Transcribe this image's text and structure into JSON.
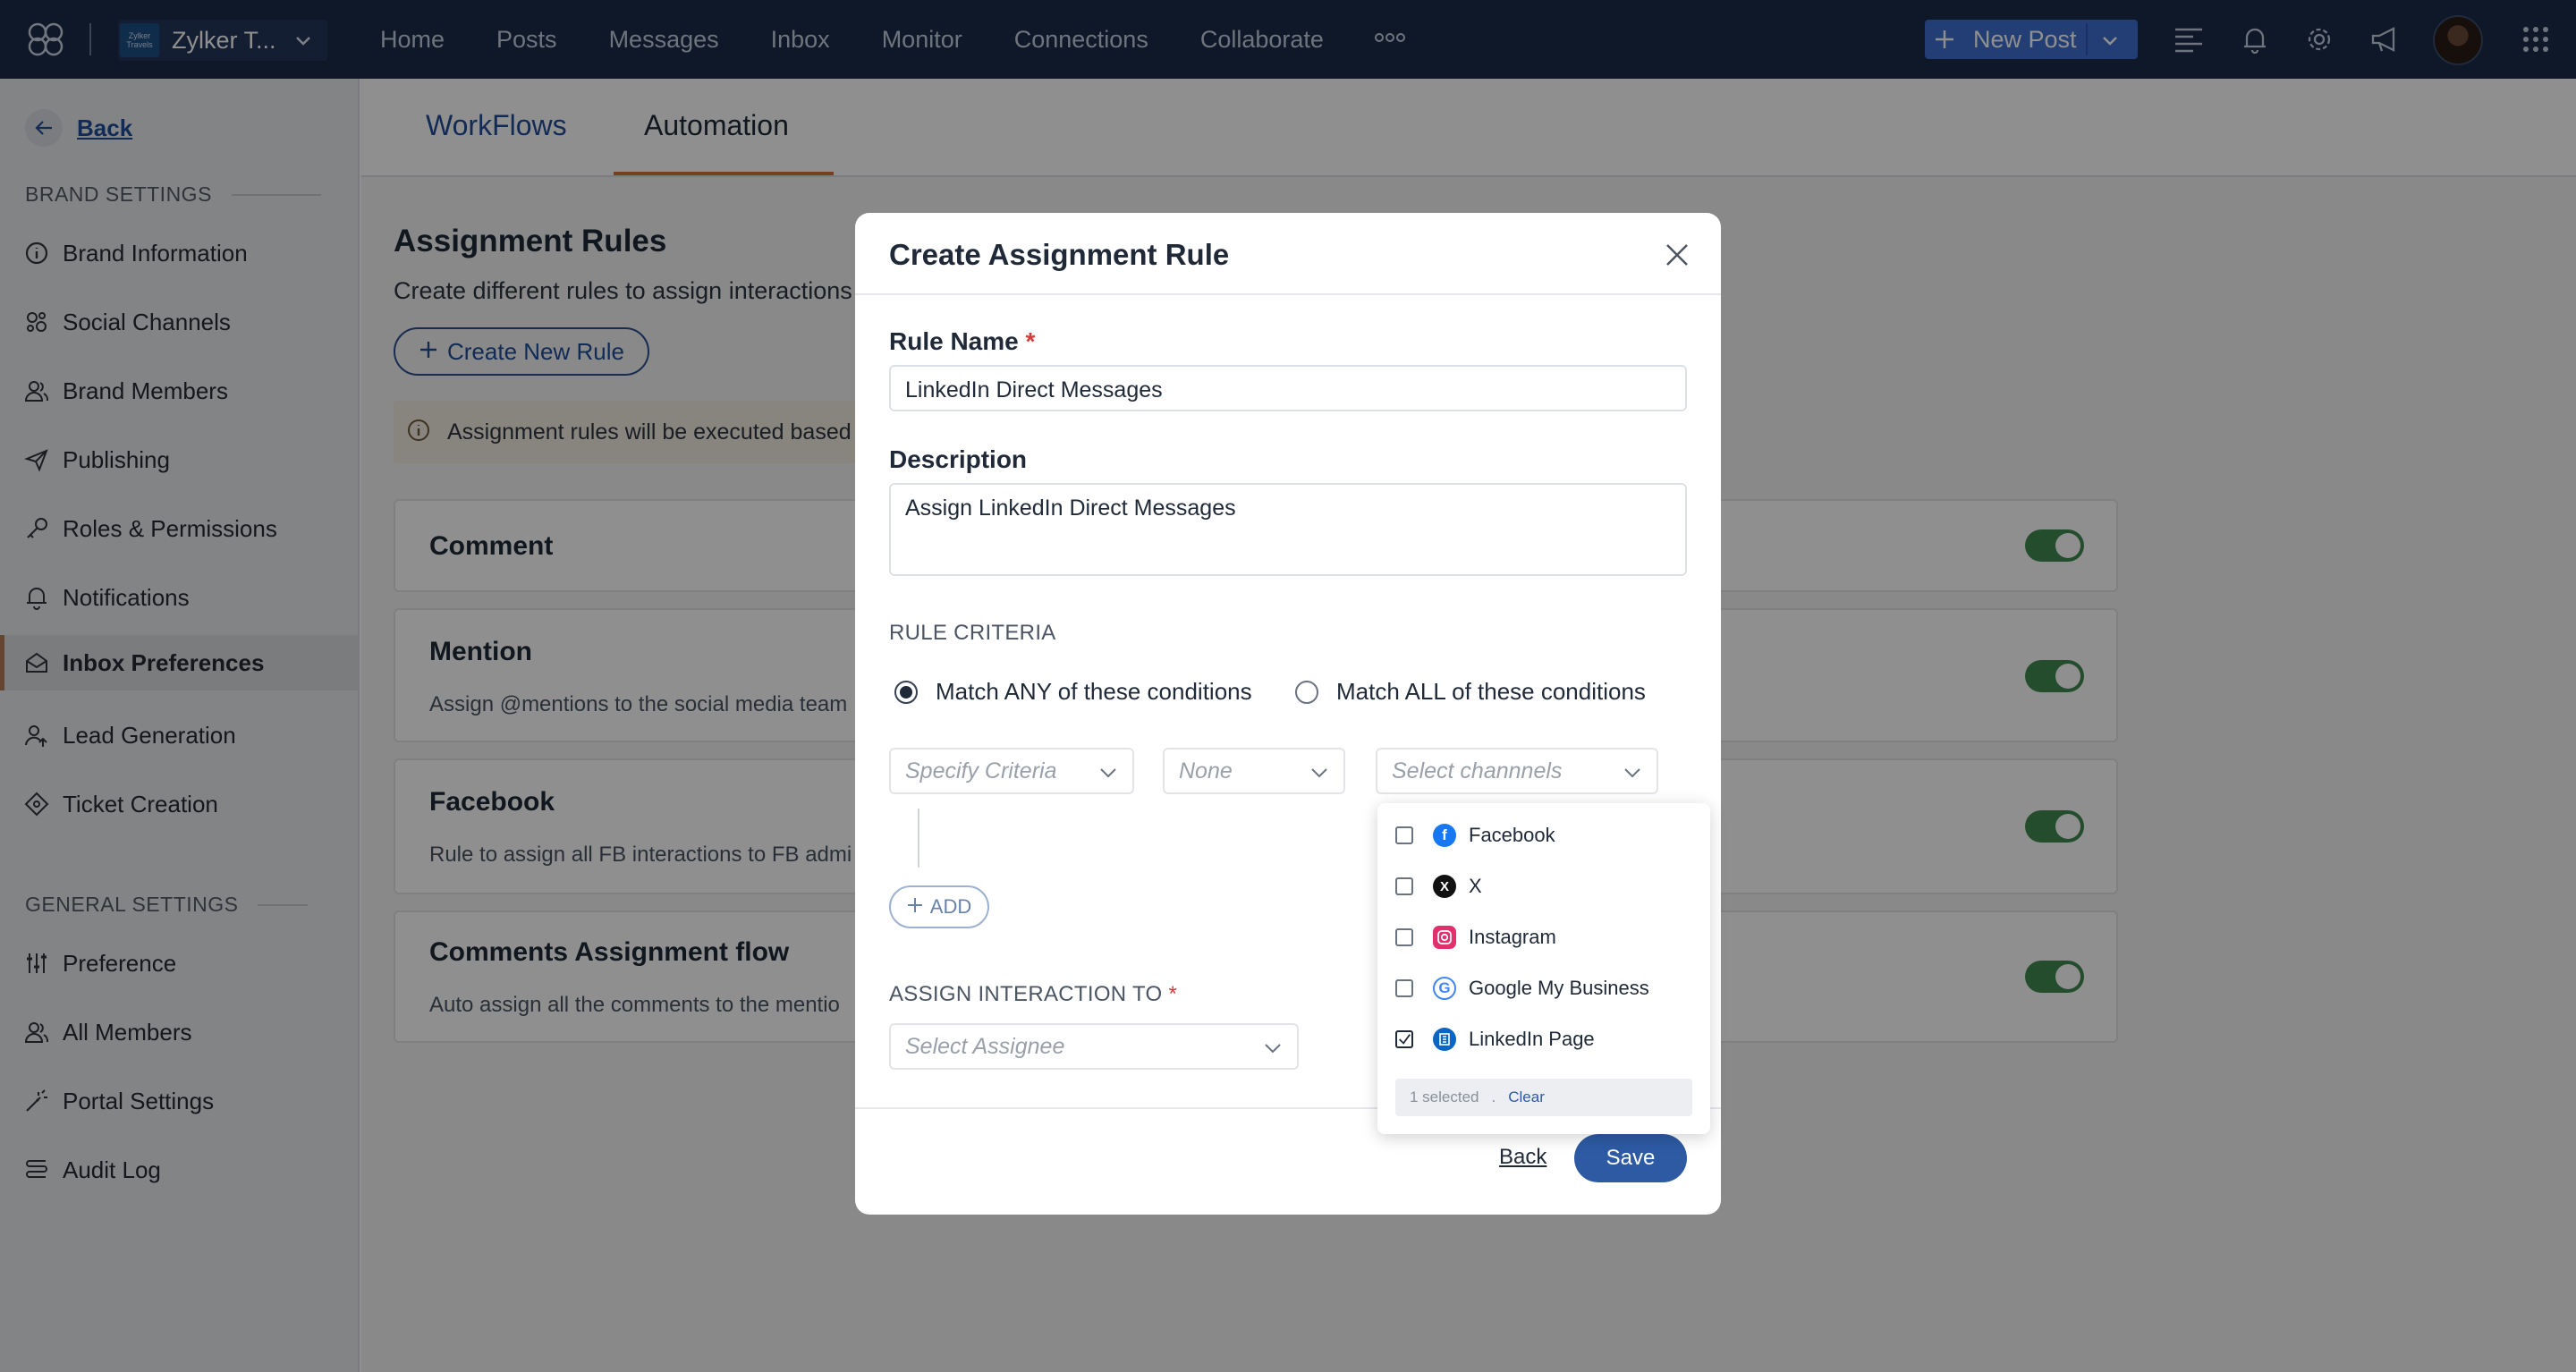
{
  "app": {
    "brand_name": "Zylker T...",
    "brand_logo_text": "Zylker Travels",
    "nav": [
      "Home",
      "Posts",
      "Messages",
      "Inbox",
      "Monitor",
      "Connections",
      "Collaborate"
    ],
    "new_post_label": "New Post"
  },
  "sidebar": {
    "back_label": "Back",
    "brand_settings_heading": "BRAND SETTINGS",
    "brand_items": [
      {
        "label": "Brand Information",
        "icon": "info-icon"
      },
      {
        "label": "Social Channels",
        "icon": "social-channels-icon"
      },
      {
        "label": "Brand Members",
        "icon": "members-icon"
      },
      {
        "label": "Publishing",
        "icon": "send-icon"
      },
      {
        "label": "Roles & Permissions",
        "icon": "key-icon"
      },
      {
        "label": "Notifications",
        "icon": "bell-icon"
      },
      {
        "label": "Inbox Preferences",
        "icon": "inbox-icon",
        "active": true
      },
      {
        "label": "Lead Generation",
        "icon": "lead-icon"
      },
      {
        "label": "Ticket Creation",
        "icon": "ticket-icon"
      }
    ],
    "general_settings_heading": "GENERAL SETTINGS",
    "general_items": [
      {
        "label": "Preference",
        "icon": "sliders-icon"
      },
      {
        "label": "All Members",
        "icon": "members-icon"
      },
      {
        "label": "Portal Settings",
        "icon": "wand-icon"
      },
      {
        "label": "Audit Log",
        "icon": "audit-log-icon"
      }
    ]
  },
  "main": {
    "tabs": [
      "WorkFlows",
      "Automation"
    ],
    "active_tab": "Automation",
    "title": "Assignment Rules",
    "subtitle": "Create different rules to assign interactions",
    "create_button": "Create New Rule",
    "info_text": "Assignment rules will be executed based",
    "rules": [
      {
        "title": "Comment",
        "description": "",
        "enabled": true
      },
      {
        "title": "Mention",
        "description": "Assign @mentions to the social media team",
        "enabled": true
      },
      {
        "title": "Facebook",
        "description": "Rule to assign all FB interactions to FB admi",
        "enabled": true
      },
      {
        "title": "Comments Assignment flow",
        "description": "Auto assign all the comments to the mentio",
        "enabled": true
      }
    ]
  },
  "modal": {
    "title": "Create Assignment Rule",
    "rule_name_label": "Rule Name",
    "rule_name_value": "LinkedIn Direct Messages",
    "description_label": "Description",
    "description_value": "Assign LinkedIn Direct Messages",
    "criteria_heading": "RULE CRITERIA",
    "match_any_label": "Match ANY of these conditions",
    "match_all_label": "Match ALL of these conditions",
    "selected_match": "any",
    "criteria_placeholder": "Specify Criteria",
    "operator_value": "None",
    "channels_placeholder": "Select channnels",
    "add_label": "ADD",
    "assign_label": "ASSIGN INTERACTION TO",
    "assignee_placeholder": "Select Assignee",
    "back_label": "Back",
    "save_label": "Save"
  },
  "channel_dropdown": {
    "options": [
      {
        "label": "Facebook",
        "icon": "facebook-icon",
        "checked": false,
        "color": "#1877f2"
      },
      {
        "label": "X",
        "icon": "x-icon",
        "checked": false,
        "color": "#111111"
      },
      {
        "label": "Instagram",
        "icon": "instagram-icon",
        "checked": false,
        "color": "#e1306c"
      },
      {
        "label": "Google My Business",
        "icon": "google-icon",
        "checked": false,
        "color": "#4285f4"
      },
      {
        "label": "LinkedIn Page",
        "icon": "linkedin-page-icon",
        "checked": true,
        "color": "#0a66c2"
      }
    ],
    "selected_count_text": "1 selected",
    "separator": ".",
    "clear_label": "Clear"
  }
}
